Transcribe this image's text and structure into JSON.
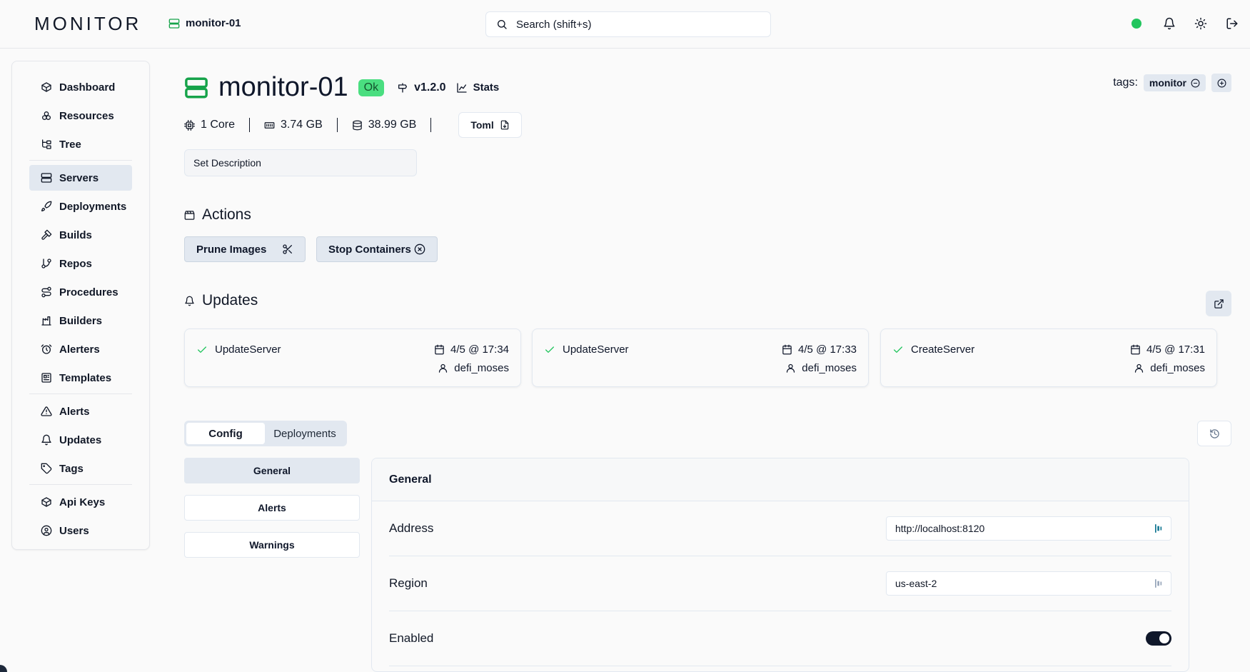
{
  "app": {
    "logo": "MONITOR",
    "breadcrumb": "monitor-01"
  },
  "search": {
    "placeholder": "Search (shift+s)"
  },
  "status": {
    "connection_color": "#22c55e"
  },
  "sidebar": {
    "groups": [
      [
        {
          "label": "Dashboard",
          "icon": "box-icon"
        },
        {
          "label": "Resources",
          "icon": "boxes-icon"
        },
        {
          "label": "Tree",
          "icon": "tree-icon"
        }
      ],
      [
        {
          "label": "Servers",
          "icon": "server-icon",
          "active": true
        },
        {
          "label": "Deployments",
          "icon": "rocket-icon"
        },
        {
          "label": "Builds",
          "icon": "hammer-icon"
        },
        {
          "label": "Repos",
          "icon": "git-branch-icon"
        },
        {
          "label": "Procedures",
          "icon": "route-icon"
        },
        {
          "label": "Builders",
          "icon": "factory-icon"
        },
        {
          "label": "Alerters",
          "icon": "alarm-icon"
        },
        {
          "label": "Templates",
          "icon": "template-icon"
        }
      ],
      [
        {
          "label": "Alerts",
          "icon": "alert-triangle-icon"
        },
        {
          "label": "Updates",
          "icon": "bell-icon"
        },
        {
          "label": "Tags",
          "icon": "tag-icon"
        }
      ],
      [
        {
          "label": "Api Keys",
          "icon": "box-icon"
        },
        {
          "label": "Users",
          "icon": "user-circle-icon"
        }
      ]
    ]
  },
  "server": {
    "name": "monitor-01",
    "state": "Ok",
    "version": "v1.2.0",
    "stats_label": "Stats",
    "tags_label": "tags:",
    "tag": "monitor",
    "cores": "1 Core",
    "memory": "3.74 GB",
    "disk": "38.99 GB",
    "toml_label": "Toml",
    "description_placeholder": "Set Description"
  },
  "actions": {
    "heading": "Actions",
    "buttons": [
      {
        "label": "Prune Images",
        "icon": "scissors-icon"
      },
      {
        "label": "Stop Containers",
        "icon": "x-circle-icon"
      }
    ]
  },
  "updates": {
    "heading": "Updates",
    "items": [
      {
        "operation": "UpdateServer",
        "time": "4/5 @ 17:34",
        "user": "defi_moses"
      },
      {
        "operation": "UpdateServer",
        "time": "4/5 @ 17:33",
        "user": "defi_moses"
      },
      {
        "operation": "CreateServer",
        "time": "4/5 @ 17:31",
        "user": "defi_moses"
      }
    ]
  },
  "config": {
    "tabs": [
      "Config",
      "Deployments"
    ],
    "sections": [
      "General",
      "Alerts",
      "Warnings"
    ],
    "panel_title": "General",
    "fields": {
      "address_label": "Address",
      "address_value": "http://localhost:8120",
      "region_label": "Region",
      "region_value": "us-east-2",
      "enabled_label": "Enabled",
      "enabled": true
    }
  }
}
